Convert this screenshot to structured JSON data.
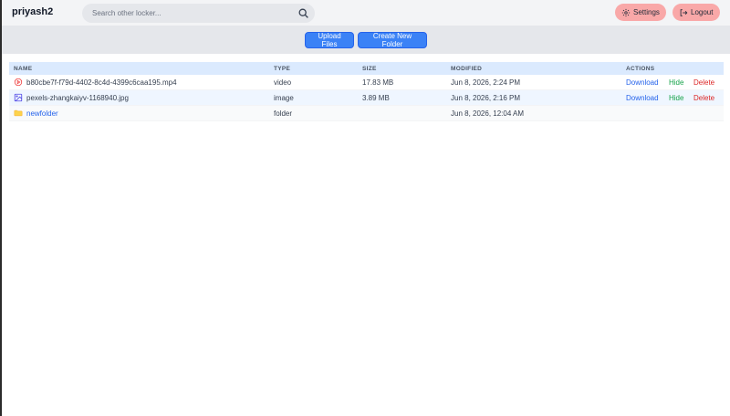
{
  "header": {
    "brand": "priyash2",
    "search_placeholder": "Search other locker...",
    "settings_label": "Settings",
    "logout_label": "Logout"
  },
  "toolbar": {
    "upload_label": "Upload Files",
    "create_folder_label": "Create New Folder"
  },
  "table": {
    "columns": [
      "NAME",
      "TYPE",
      "SIZE",
      "MODIFIED",
      "ACTIONS"
    ],
    "rows": [
      {
        "name": "b80cbe7f-f79d-4402-8c4d-4399c6caa195.mp4",
        "type": "video",
        "size": "17.83 MB",
        "modified": "Jun 8, 2026, 2:24 PM",
        "icon": "video-icon",
        "actions": [
          "Download",
          "Hide",
          "Delete"
        ]
      },
      {
        "name": "pexels-zhangkaiyv-1168940.jpg",
        "type": "image",
        "size": "3.89 MB",
        "modified": "Jun 8, 2026, 2:16 PM",
        "icon": "image-icon",
        "actions": [
          "Download",
          "Hide",
          "Delete"
        ]
      },
      {
        "name": "newfolder",
        "type": "folder",
        "size": "",
        "modified": "Jun 8, 2026, 12:04 AM",
        "icon": "folder-icon",
        "actions": []
      }
    ]
  },
  "colors": {
    "accent": "#3b82f6",
    "header_button": "#f9a8a8",
    "download": "#2563eb",
    "hide": "#16a34a",
    "delete": "#dc2626"
  }
}
